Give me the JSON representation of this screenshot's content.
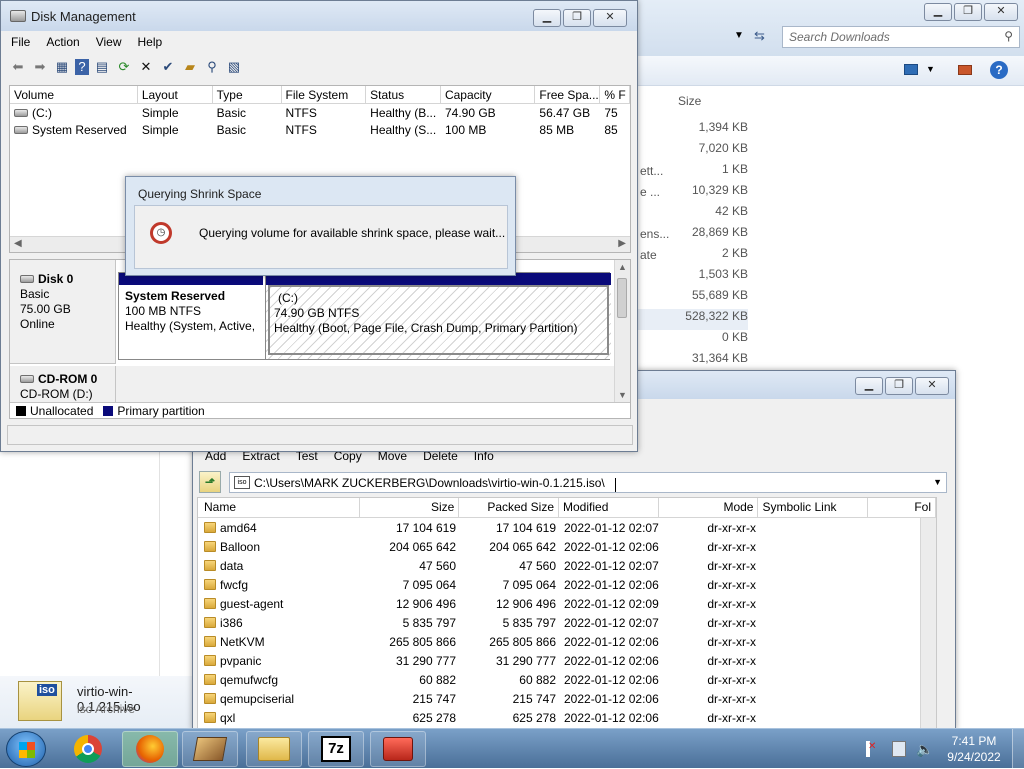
{
  "explorer": {
    "search_placeholder": "Search Downloads",
    "size_header": "Size",
    "sizes": [
      "1,394 KB",
      "7,020 KB",
      "1 KB",
      "10,329 KB",
      "42 KB",
      "28,869 KB",
      "2 KB",
      "1,503 KB",
      "55,689 KB",
      "528,322 KB",
      "0 KB",
      "31,364 KB"
    ],
    "truncated_names": [
      "ett...",
      "e ...",
      "ens...",
      "ate"
    ],
    "status_filename": "virtio-win-0.1.215.iso",
    "status_type": "iso Archive",
    "file_icon_label": "iso"
  },
  "disk_mgmt": {
    "title": "Disk Management",
    "menu": [
      "File",
      "Action",
      "View",
      "Help"
    ],
    "columns": [
      "Volume",
      "Layout",
      "Type",
      "File System",
      "Status",
      "Capacity",
      "Free Spa...",
      "% F"
    ],
    "volumes": [
      {
        "name": "(C:)",
        "layout": "Simple",
        "type": "Basic",
        "fs": "NTFS",
        "status": "Healthy (B...",
        "capacity": "74.90 GB",
        "free": "56.47 GB",
        "pct": "75"
      },
      {
        "name": "System Reserved",
        "layout": "Simple",
        "type": "Basic",
        "fs": "NTFS",
        "status": "Healthy (S...",
        "capacity": "100 MB",
        "free": "85 MB",
        "pct": "85"
      }
    ],
    "disk0": {
      "name": "Disk 0",
      "type": "Basic",
      "size": "75.00 GB",
      "state": "Online"
    },
    "partitions": [
      {
        "name": "System Reserved",
        "size": "100 MB NTFS",
        "status": "Healthy (System, Active,"
      },
      {
        "name": "(C:)",
        "size": "74.90 GB NTFS",
        "status": "Healthy (Boot, Page File, Crash Dump, Primary Partition)"
      }
    ],
    "cdrom": {
      "name": "CD-ROM 0",
      "drive": "CD-ROM (D:)"
    },
    "legend": [
      "Unallocated",
      "Primary partition"
    ]
  },
  "dialog": {
    "title": "Querying Shrink Space",
    "message": "Querying volume for available shrink space, please wait..."
  },
  "zip": {
    "toolbar": [
      "Add",
      "Extract",
      "Test",
      "Copy",
      "Move",
      "Delete",
      "Info"
    ],
    "path": "C:\\Users\\MARK ZUCKERBERG\\Downloads\\virtio-win-0.1.215.iso\\",
    "columns": [
      "Name",
      "Size",
      "Packed Size",
      "Modified",
      "Mode",
      "Symbolic Link",
      "Fol"
    ],
    "rows": [
      {
        "name": "amd64",
        "size": "17 104 619",
        "packed": "17 104 619",
        "modified": "2022-01-12 02:07",
        "mode": "dr-xr-xr-x"
      },
      {
        "name": "Balloon",
        "size": "204 065 642",
        "packed": "204 065 642",
        "modified": "2022-01-12 02:06",
        "mode": "dr-xr-xr-x"
      },
      {
        "name": "data",
        "size": "47 560",
        "packed": "47 560",
        "modified": "2022-01-12 02:07",
        "mode": "dr-xr-xr-x"
      },
      {
        "name": "fwcfg",
        "size": "7 095 064",
        "packed": "7 095 064",
        "modified": "2022-01-12 02:06",
        "mode": "dr-xr-xr-x"
      },
      {
        "name": "guest-agent",
        "size": "12 906 496",
        "packed": "12 906 496",
        "modified": "2022-01-12 02:09",
        "mode": "dr-xr-xr-x"
      },
      {
        "name": "i386",
        "size": "5 835 797",
        "packed": "5 835 797",
        "modified": "2022-01-12 02:07",
        "mode": "dr-xr-xr-x"
      },
      {
        "name": "NetKVM",
        "size": "265 805 866",
        "packed": "265 805 866",
        "modified": "2022-01-12 02:06",
        "mode": "dr-xr-xr-x"
      },
      {
        "name": "pvpanic",
        "size": "31 290 777",
        "packed": "31 290 777",
        "modified": "2022-01-12 02:06",
        "mode": "dr-xr-xr-x"
      },
      {
        "name": "qemufwcfg",
        "size": "60 882",
        "packed": "60 882",
        "modified": "2022-01-12 02:06",
        "mode": "dr-xr-xr-x"
      },
      {
        "name": "qemupciserial",
        "size": "215 747",
        "packed": "215 747",
        "modified": "2022-01-12 02:06",
        "mode": "dr-xr-xr-x"
      },
      {
        "name": "qxl",
        "size": "625 278",
        "packed": "625 278",
        "modified": "2022-01-12 02:06",
        "mode": "dr-xr-xr-x"
      }
    ]
  },
  "taskbar": {
    "time": "7:41 PM",
    "date": "9/24/2022",
    "apps": [
      "start-orb",
      "chrome",
      "firefox",
      "paint",
      "explorer",
      "7zip",
      "toolbox"
    ],
    "zip_app_label": "7z"
  },
  "colors": {
    "primary_partition": "#0a0a7a",
    "unallocated": "#000000",
    "taskbar": "#5a7fa8"
  }
}
